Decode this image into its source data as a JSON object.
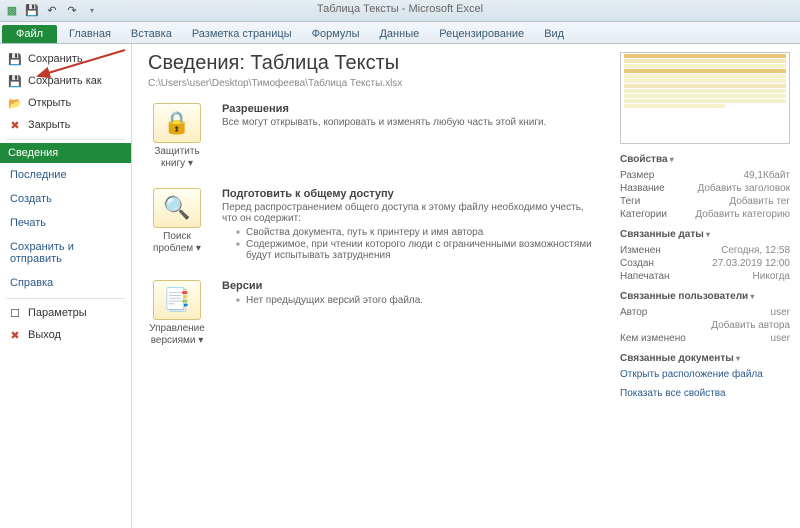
{
  "window": {
    "title": "Таблица Тексты - Microsoft Excel"
  },
  "tabs": {
    "file": "Файл",
    "home": "Главная",
    "insert": "Вставка",
    "layout": "Разметка страницы",
    "formulas": "Формулы",
    "data": "Данные",
    "review": "Рецензирование",
    "view": "Вид"
  },
  "sidebar": {
    "save": "Сохранить",
    "saveas": "Сохранить как",
    "open": "Открыть",
    "close": "Закрыть",
    "info": "Сведения",
    "recent": "Последние",
    "new": "Создать",
    "print": "Печать",
    "share": "Сохранить и отправить",
    "help": "Справка",
    "options": "Параметры",
    "exit": "Выход"
  },
  "info": {
    "heading": "Сведения: Таблица Тексты",
    "path": "C:\\Users\\user\\Desktop\\Тимофеева\\Таблица Тексты.xlsx",
    "perm_title": "Разрешения",
    "perm_text": "Все могут открывать, копировать и изменять любую часть этой книги.",
    "protect_btn": "Защитить книгу ▾",
    "share_title": "Подготовить к общему доступу",
    "share_text": "Перед распространением общего доступа к этому файлу необходимо учесть, что он содержит:",
    "share_b1": "Свойства документа, путь к принтеру и имя автора",
    "share_b2": "Содержимое, при чтении которого люди с ограниченными возможностями будут испытывать затруднения",
    "check_btn": "Поиск проблем ▾",
    "ver_title": "Версии",
    "ver_text": "Нет предыдущих версий этого файла.",
    "ver_btn": "Управление версиями ▾"
  },
  "props": {
    "h1": "Свойства",
    "size_k": "Размер",
    "size_v": "49,1Кбайт",
    "title_k": "Название",
    "title_v": "Добавить заголовок",
    "tags_k": "Теги",
    "tags_v": "Добавить тег",
    "cat_k": "Категории",
    "cat_v": "Добавить категорию",
    "h2": "Связанные даты",
    "mod_k": "Изменен",
    "mod_v": "Сегодня, 12:58",
    "cre_k": "Создан",
    "cre_v": "27.03.2019 12:00",
    "prn_k": "Напечатан",
    "prn_v": "Никогда",
    "h3": "Связанные пользователи",
    "auth_k": "Автор",
    "auth_v": "user",
    "auth_add": "Добавить автора",
    "chg_k": "Кем изменено",
    "chg_v": "user",
    "h4": "Связанные документы",
    "openloc": "Открыть расположение файла",
    "showall": "Показать все свойства"
  }
}
